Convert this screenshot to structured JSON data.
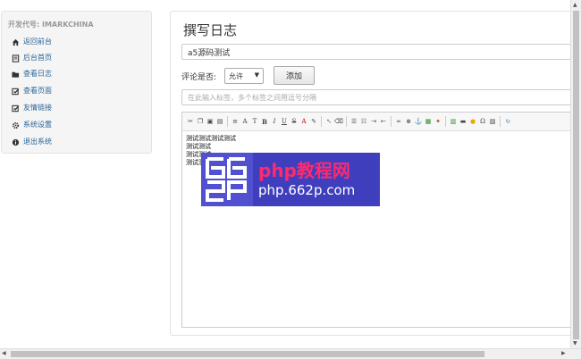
{
  "sidebar": {
    "header": "开发代号: IMARKCHINA",
    "items": [
      {
        "label": "返回前台",
        "icon": "home-icon"
      },
      {
        "label": "后台首页",
        "icon": "book-icon"
      },
      {
        "label": "查看日志",
        "icon": "folder-open-icon"
      },
      {
        "label": "查看页面",
        "icon": "edit-check-icon"
      },
      {
        "label": "友情链接",
        "icon": "edit-check-icon"
      },
      {
        "label": "系统设置",
        "icon": "gear-icon"
      },
      {
        "label": "退出系统",
        "icon": "info-icon"
      }
    ]
  },
  "main": {
    "title": "撰写日志",
    "post_title_value": "a5源码测试",
    "comment_label": "评论是否:",
    "comment_selected": "允许",
    "add_button": "添加",
    "tags_placeholder": "在此输入标签，多个标签之间用逗号分隔",
    "editor_lines": [
      "测试测试测试测试",
      "测试测试",
      "测试测试",
      "测试测试"
    ]
  },
  "watermark": {
    "logo_text": "662p",
    "title": "php教程网",
    "url": "php.662p.com"
  },
  "colors": {
    "link": "#2a6496",
    "watermark_bg": "#3f3fbe",
    "watermark_accent": "#ff2a6d"
  }
}
